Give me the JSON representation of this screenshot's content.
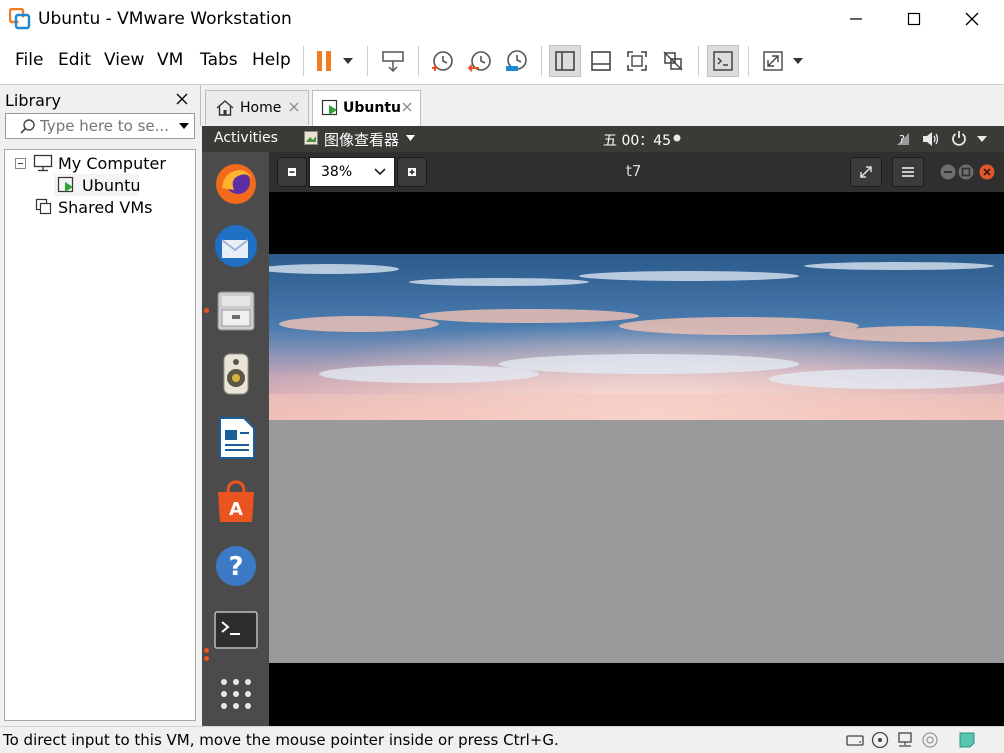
{
  "window": {
    "title": "Ubuntu - VMware Workstation"
  },
  "menu": {
    "items": [
      "File",
      "Edit",
      "View",
      "VM",
      "Tabs",
      "Help"
    ]
  },
  "library": {
    "title": "Library",
    "search_placeholder": "Type here to se...",
    "tree": {
      "my_computer": "My Computer",
      "vm": "Ubuntu",
      "shared": "Shared VMs"
    }
  },
  "tabs": [
    {
      "label": "Home"
    },
    {
      "label": "Ubuntu"
    }
  ],
  "guest": {
    "activities": "Activities",
    "app_menu": "图像查看器",
    "clock": "五 00：45",
    "viewer": {
      "zoom": "38%",
      "image_title": "t7"
    }
  },
  "status": {
    "text": "To direct input to this VM, move the mouse pointer inside or press Ctrl+G."
  },
  "colors": {
    "pause_orange": "#f47b20",
    "ubuntu_orange": "#e95420",
    "vmware_blue": "#1e88d4"
  }
}
